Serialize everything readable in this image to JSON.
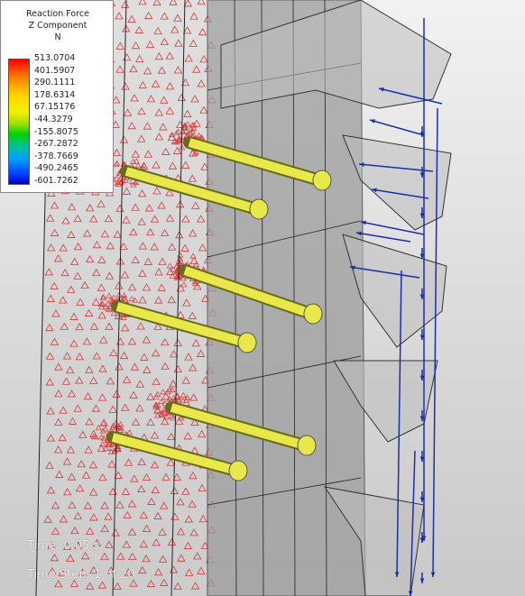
{
  "legend": {
    "title": "Reaction Force",
    "subtitle": "Z Component",
    "unit": "N",
    "values": [
      "513.0704",
      "401.5907",
      "290.1111",
      "178.6314",
      "67.15176",
      "-44.3279",
      "-155.8075",
      "-267.2872",
      "-378.7669",
      "-490.2465",
      "-601.7262"
    ]
  },
  "status": {
    "time_label": "Time: 0.05 s",
    "step_label": "Time Step: 1 of 20"
  },
  "colors": {
    "triangle": "#d63a3a",
    "bolt": "#e8e84a",
    "arrow": "#1a2fb0",
    "panel": "#9a9a9a"
  }
}
